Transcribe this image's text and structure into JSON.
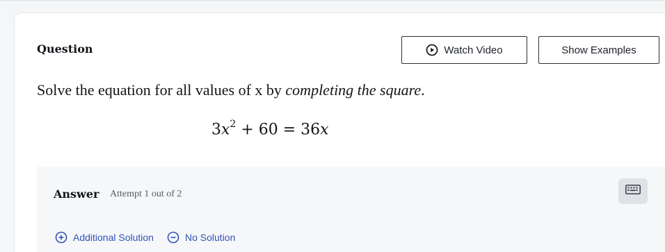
{
  "question": {
    "title": "Question",
    "watch_video_label": "Watch Video",
    "show_examples_label": "Show Examples",
    "prompt_plain": "Solve the equation for all values of x by ",
    "prompt_italic": "completing the square",
    "prompt_end": ".",
    "equation": {
      "coef": "3",
      "var": "x",
      "exp": "2",
      "rest": " + 60 = 36",
      "var2": "x"
    }
  },
  "answer": {
    "label": "Answer",
    "attempt": "Attempt 1 out of 2",
    "additional_solution_label": "Additional Solution",
    "no_solution_label": "No Solution"
  },
  "icons": {
    "watch_video": "play-circle-icon",
    "keyboard": "keyboard-icon",
    "additional": "plus-circle-icon",
    "none": "minus-circle-icon"
  },
  "colors": {
    "accent": "#2f53b8",
    "border": "#2a2f36",
    "answer_bg": "#f6f7f9",
    "keyboard_bg": "#dfe2e6"
  }
}
